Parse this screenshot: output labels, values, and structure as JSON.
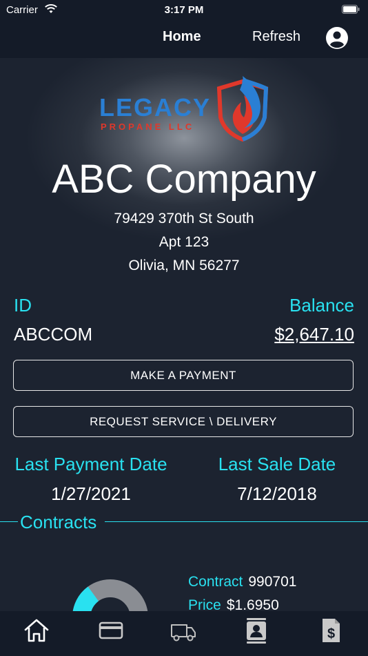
{
  "status_bar": {
    "carrier": "Carrier",
    "time": "3:17 PM"
  },
  "nav": {
    "home_label": "Home",
    "refresh_label": "Refresh",
    "profile_icon": "person-circle-icon"
  },
  "logo": {
    "line1": "LEGACY",
    "line2": "PROPANE LLC"
  },
  "customer": {
    "name": "ABC Company",
    "address_line1": "79429 370th St South",
    "address_line2": "Apt 123",
    "address_line3": "Olivia, MN 56277"
  },
  "account": {
    "id_label": "ID",
    "id_value": "ABCCOM",
    "balance_label": "Balance",
    "balance_value": "$2,647.10"
  },
  "actions": {
    "make_payment": "MAKE A PAYMENT",
    "request_service": "REQUEST SERVICE \\ DELIVERY"
  },
  "dates": {
    "last_payment_label": "Last Payment Date",
    "last_payment_value": "1/27/2021",
    "last_sale_label": "Last Sale Date",
    "last_sale_value": "7/12/2018"
  },
  "contracts": {
    "title": "Contracts",
    "contract_label": "Contract",
    "contract_value": "990701",
    "price_label": "Price",
    "price_value": "$1.6950",
    "gauge_fill_fraction": 0.3
  },
  "tab_bar": {
    "items": [
      "home-icon",
      "credit-card-icon",
      "truck-icon",
      "contact-card-icon",
      "invoice-icon"
    ]
  },
  "colors": {
    "accent": "#29e1f0",
    "background": "#141b28",
    "logo_blue": "#2a7fd4",
    "logo_red": "#e0382b"
  }
}
